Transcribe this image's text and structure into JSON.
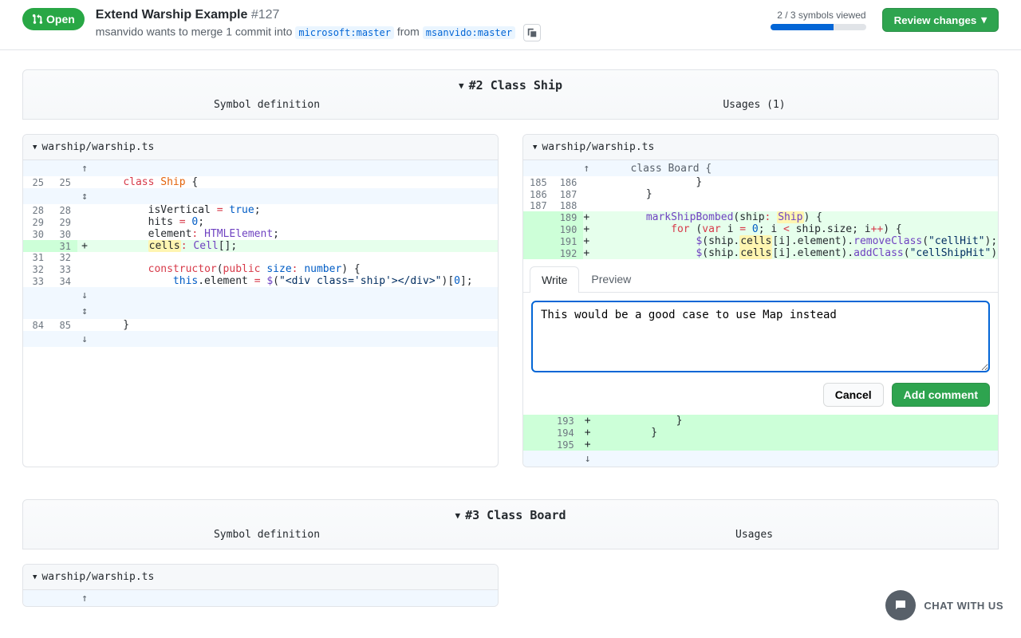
{
  "header": {
    "badge": "Open",
    "title": "Extend Warship Example",
    "number": "#127",
    "author": "msanvido",
    "merge_text_1": " wants to merge 1 commit into ",
    "base_ref": "microsoft:master",
    "merge_text_2": " from ",
    "head_ref": "msanvido:master",
    "symbols_viewed": "2 / 3 symbols viewed",
    "review_btn": "Review changes"
  },
  "section1": {
    "title": "#2 Class Ship",
    "col_left": "Symbol definition",
    "col_right": "Usages (1)"
  },
  "section2": {
    "title": "#3 Class Board",
    "col_left": "Symbol definition",
    "col_right": "Usages"
  },
  "file_path": "warship/warship.ts",
  "left_diff": {
    "rows": [
      {
        "cls": "exp",
        "a": "",
        "b": "",
        "sign": "↑",
        "code": ""
      },
      {
        "cls": "ctx",
        "a": "25",
        "b": "25",
        "sign": "",
        "code": "    <span class='k-red'>class</span> <span class='k-orange'>Ship</span> {"
      },
      {
        "cls": "exp",
        "a": "",
        "b": "",
        "sign": "↕",
        "code": ""
      },
      {
        "cls": "ctx",
        "a": "28",
        "b": "28",
        "sign": "",
        "code": "        isVertical <span class='k-red'>=</span> <span class='k-blue'>true</span>;"
      },
      {
        "cls": "ctx",
        "a": "29",
        "b": "29",
        "sign": "",
        "code": "        hits <span class='k-red'>=</span> <span class='k-blue'>0</span>;"
      },
      {
        "cls": "ctx",
        "a": "30",
        "b": "30",
        "sign": "",
        "code": "        element<span class='k-red'>:</span> <span class='k-purple'>HTMLElement</span>;"
      },
      {
        "cls": "add",
        "a": "",
        "b": "31",
        "sign": "+",
        "code": "        <span class='hl'>cells</span><span class='k-red'>:</span> <span class='k-purple'>Cell</span>[];"
      },
      {
        "cls": "ctx",
        "a": "31",
        "b": "32",
        "sign": "",
        "code": ""
      },
      {
        "cls": "ctx",
        "a": "32",
        "b": "33",
        "sign": "",
        "code": "        <span class='k-red'>constructor</span>(<span class='k-red'>public</span> <span class='k-blue'>size</span><span class='k-red'>:</span> <span class='k-blue'>number</span>) {"
      },
      {
        "cls": "ctx",
        "a": "33",
        "b": "34",
        "sign": "",
        "code": "            <span class='k-blue'>this</span>.element <span class='k-red'>=</span> <span class='k-purple'>$</span>(<span class='k-nav'>\"&lt;div class='ship'&gt;&lt;/div&gt;\"</span>)[<span class='k-blue'>0</span>];"
      },
      {
        "cls": "exp",
        "a": "",
        "b": "",
        "sign": "↓",
        "code": ""
      },
      {
        "cls": "exp",
        "a": "",
        "b": "",
        "sign": "↕",
        "code": ""
      },
      {
        "cls": "ctx",
        "a": "84",
        "b": "85",
        "sign": "",
        "code": "    }"
      },
      {
        "cls": "exp",
        "a": "",
        "b": "",
        "sign": "↓",
        "code": ""
      }
    ]
  },
  "right_diff": {
    "rows": [
      {
        "cls": "exp",
        "a": "",
        "b": "",
        "sign": "↑",
        "code": "    class Board {",
        "wide": true
      },
      {
        "cls": "ctx",
        "a": "185",
        "b": "186",
        "sign": "",
        "code": "                }"
      },
      {
        "cls": "ctx",
        "a": "186",
        "b": "187",
        "sign": "",
        "code": "        }"
      },
      {
        "cls": "ctx",
        "a": "187",
        "b": "188",
        "sign": "",
        "code": ""
      },
      {
        "cls": "add",
        "a": "",
        "b": "189",
        "sign": "+",
        "code": "        <span class='k-purple'>markShipBombed</span>(ship<span class='k-red'>:</span> <span class='hl'><span class='k-purple'>Ship</span></span>) {"
      },
      {
        "cls": "add",
        "a": "",
        "b": "190",
        "sign": "+",
        "code": "            <span class='k-red'>for</span> (<span class='k-red'>var</span> i <span class='k-red'>=</span> <span class='k-blue'>0</span>; i <span class='k-red'>&lt;</span> ship.size; i<span class='k-red'>++</span>) {"
      },
      {
        "cls": "add",
        "a": "",
        "b": "191",
        "sign": "+",
        "code": "                <span class='k-purple'>$</span>(ship.<span class='hl'>cells</span>[i].element).<span class='k-purple'>removeClass</span>(<span class='k-nav'>\"cellHit\"</span>);"
      },
      {
        "cls": "add",
        "a": "",
        "b": "192",
        "sign": "+",
        "code": "                <span class='k-purple'>$</span>(ship.<span class='hl'>cells</span>[i].element).<span class='k-purple'>addClass</span>(<span class='k-nav'>\"cellShipHit\"</span>);"
      }
    ],
    "rows_after": [
      {
        "cls": "addstrong",
        "a": "",
        "b": "193",
        "sign": "+",
        "code": "            }"
      },
      {
        "cls": "addstrong",
        "a": "",
        "b": "194",
        "sign": "+",
        "code": "        }"
      },
      {
        "cls": "addstrong",
        "a": "",
        "b": "195",
        "sign": "+",
        "code": ""
      },
      {
        "cls": "exp",
        "a": "",
        "b": "",
        "sign": "↓",
        "code": ""
      }
    ]
  },
  "comment": {
    "write_tab": "Write",
    "preview_tab": "Preview",
    "text": "This would be a good case to use Map instead",
    "cancel": "Cancel",
    "submit": "Add comment"
  },
  "chat_label": "CHAT WITH US"
}
